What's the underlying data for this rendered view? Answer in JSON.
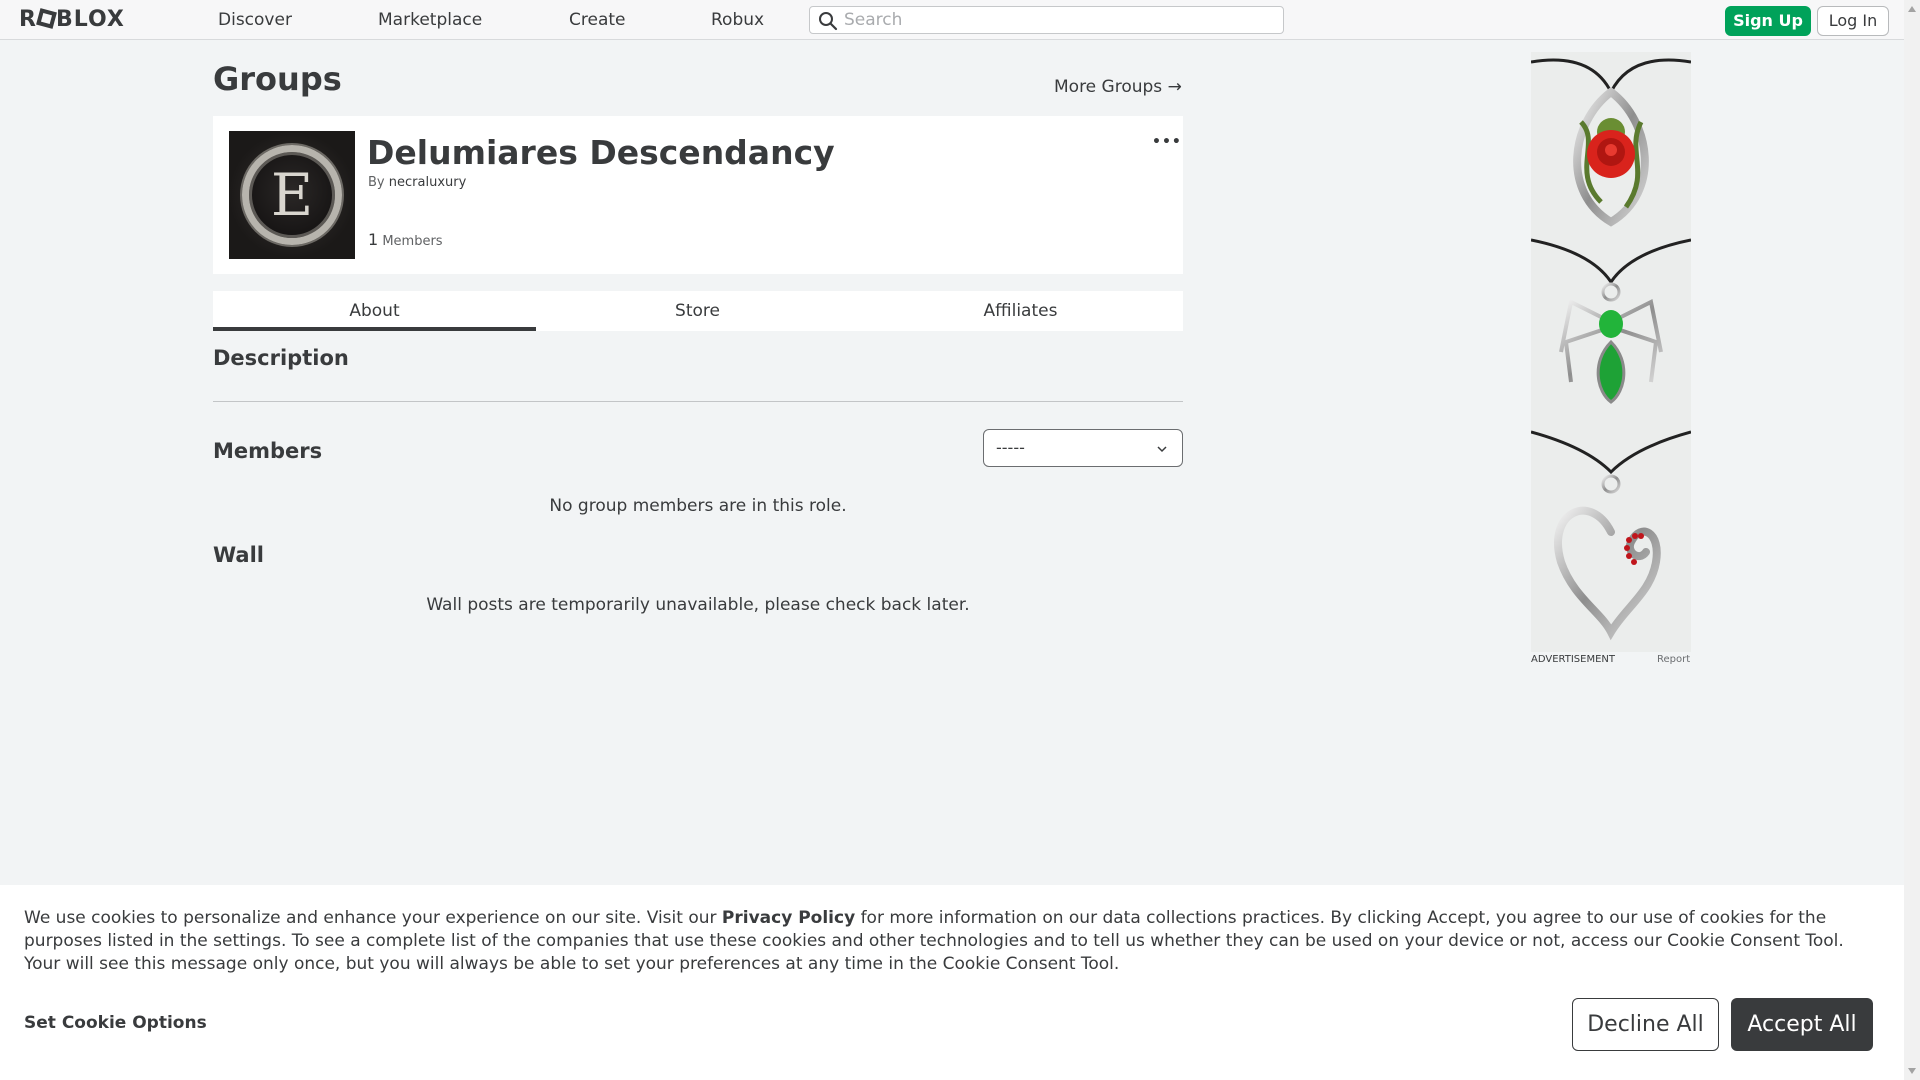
{
  "nav": {
    "logo": "ROBLOX",
    "links": [
      "Discover",
      "Marketplace",
      "Create",
      "Robux"
    ],
    "search_placeholder": "Search",
    "signup_label": "Sign Up",
    "login_label": "Log In",
    "accent_color": "#00a25a"
  },
  "groups": {
    "page_title": "Groups",
    "more_groups_label": "More Groups →",
    "group": {
      "name": "Delumiares Descendancy",
      "by_label": "By",
      "owner": "necraluxury",
      "member_count": "1",
      "members_label": "Members",
      "emblem_letter": "E",
      "menu_label": "•••"
    },
    "tabs": [
      "About",
      "Store",
      "Affiliates"
    ],
    "active_tab": "About",
    "description_title": "Description",
    "members_title": "Members",
    "role_select_value": "-----",
    "members_empty": "No group members are in this role.",
    "wall_title": "Wall",
    "wall_message": "Wall posts are temporarily unavailable, please check back later."
  },
  "ad": {
    "label": "ADVERTISEMENT",
    "report_label": "Report"
  },
  "cookie": {
    "text_before": "We use cookies to personalize and enhance your experience on our site. Visit our ",
    "privacy_link": "Privacy Policy",
    "text_after": " for more information on our data collections practices. By clicking Accept, you agree to our use of cookies for the purposes listed in the settings. To see a complete list of the companies that use these cookies and other technologies and to tell us whether they can be used on your device or not, access our Cookie Consent Tool. Your will see this message only once, but you will always be able to set your preferences at any time in the Cookie Consent Tool.",
    "options_label": "Set Cookie Options",
    "decline_label": "Decline All",
    "accept_label": "Accept All"
  }
}
